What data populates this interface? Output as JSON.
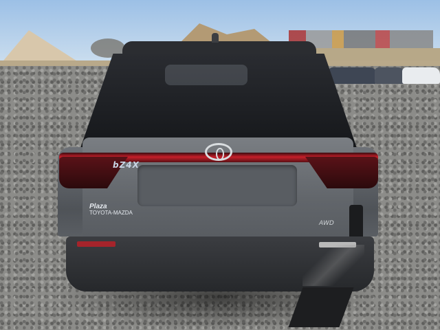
{
  "photo": {
    "subject": "vehicle-rear",
    "badges": {
      "model": "bZ4X",
      "dealer_line1": "Plaza",
      "dealer_line2": "TOYOTA-MAZDA",
      "awd": "AWD"
    }
  }
}
